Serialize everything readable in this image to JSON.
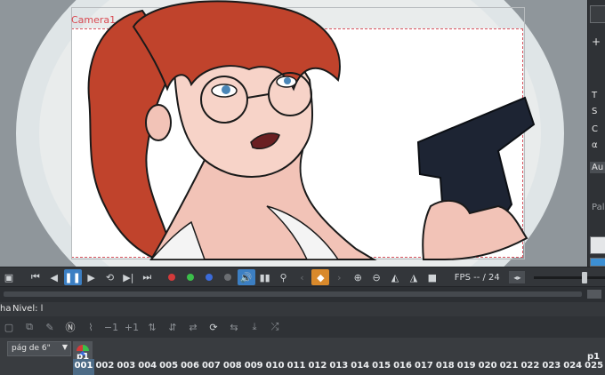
{
  "viewer": {
    "camera_label": "Camera1"
  },
  "right_panel": {
    "letters": [
      "T",
      "S",
      "C",
      "α"
    ],
    "dropdown_label": "Au",
    "section_label": "Pal"
  },
  "playbar": {
    "fps_text": "FPS -- / 24",
    "color_dots": [
      "#d33a3a",
      "#3bbf4a",
      "#3b6bd9",
      "#6b6e72"
    ],
    "frame_rate_slider_value": 0.67
  },
  "level_bar": {
    "left_fragment": "ha",
    "level_label": "Nivel: l"
  },
  "page_selector": {
    "value": "pág de 6\""
  },
  "timeline": {
    "current_key_label": "p1",
    "right_label": "p1",
    "frames": [
      "001",
      "002",
      "003",
      "004",
      "005",
      "006",
      "007",
      "008",
      "009",
      "010",
      "011",
      "012",
      "013",
      "014",
      "015",
      "016",
      "017",
      "018",
      "019",
      "020",
      "021",
      "022",
      "023",
      "024",
      "025"
    ],
    "current_frame": "001"
  },
  "colors": {
    "accent": "#3c7fc3",
    "key_orange": "#d9892b",
    "hair": "#c0432c"
  }
}
